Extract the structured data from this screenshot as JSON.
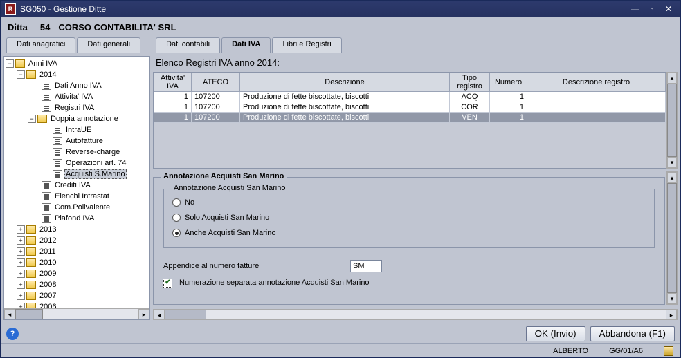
{
  "window_title": "SG050 - Gestione Ditte",
  "header": {
    "ditta_label": "Ditta",
    "ditta_num": "54",
    "ditta_name": "CORSO CONTABILITA' SRL"
  },
  "tabs": {
    "t0": "Dati anagrafici",
    "t1": "Dati generali",
    "t2": "Dati contabili",
    "t3": "Dati IVA",
    "t4": "Libri e Registri"
  },
  "tree": {
    "root": "Anni IVA",
    "year": "2014",
    "items": {
      "dati_anno_iva": "Dati Anno IVA",
      "attivita_iva": "Attivita' IVA",
      "registri_iva": "Registri IVA",
      "doppia_annotazione": "Doppia annotazione",
      "intraue": "IntraUE",
      "autofatture": "Autofatture",
      "reverse_charge": "Reverse-charge",
      "operazioni_art74": "Operazioni art. 74",
      "acquisti_smarino": "Acquisti S.Marino",
      "crediti_iva": "Crediti IVA",
      "elenchi_intrastat": "Elenchi Intrastat",
      "com_polivalente": "Com.Polivalente",
      "plafond_iva": "Plafond IVA"
    },
    "years": [
      "2013",
      "2012",
      "2011",
      "2010",
      "2009",
      "2008",
      "2007",
      "2006"
    ]
  },
  "grid": {
    "caption": "Elenco Registri IVA anno 2014:",
    "headers": {
      "attivita": "Attivita' IVA",
      "ateco": "ATECO",
      "descrizione": "Descrizione",
      "tipo": "Tipo registro",
      "numero": "Numero",
      "desc_registro": "Descrizione registro"
    },
    "rows": [
      {
        "att": "1",
        "ateco": "107200",
        "desc": "Produzione di fette biscottate, biscotti",
        "tipo": "ACQ",
        "num": "1",
        "dreg": ""
      },
      {
        "att": "1",
        "ateco": "107200",
        "desc": "Produzione di fette biscottate, biscotti",
        "tipo": "COR",
        "num": "1",
        "dreg": ""
      },
      {
        "att": "1",
        "ateco": "107200",
        "desc": "Produzione di fette biscottate, biscotti",
        "tipo": "VEN",
        "num": "1",
        "dreg": ""
      }
    ]
  },
  "form": {
    "fieldset_title": "Annotazione Acquisti San Marino",
    "inner_title": "Annotazione Acquisti San Marino",
    "radio_no": "No",
    "radio_solo": "Solo Acquisti San Marino",
    "radio_anche": "Anche Acquisti San Marino",
    "appendice_label": "Appendice al numero fatture",
    "appendice_value": "SM",
    "checkbox_label": "Numerazione separata annotazione Acquisti San Marino"
  },
  "buttons": {
    "ok": "OK (Invio)",
    "abbandona": "Abbandona (F1)"
  },
  "status": {
    "user": "ALBERTO",
    "code": "GG/01/A6"
  }
}
